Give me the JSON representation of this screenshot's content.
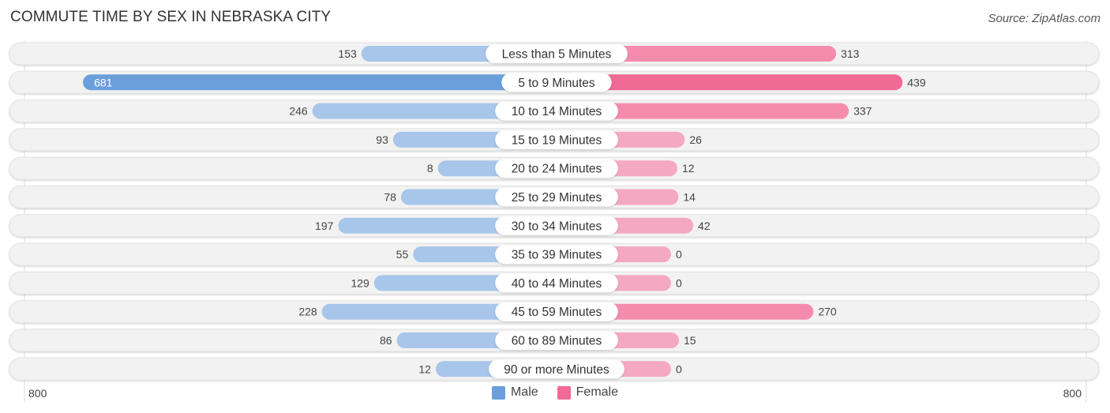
{
  "header": {
    "title": "COMMUTE TIME BY SEX IN NEBRASKA CITY",
    "source": "Source: ZipAtlas.com"
  },
  "legend": {
    "male_label": "Male",
    "female_label": "Female"
  },
  "colors": {
    "male": "#6a9fdb",
    "male_light": "#a7c6ea",
    "female": "#f06a95",
    "female_light": "#f5a8c1",
    "track": "#f2f2f2"
  },
  "chart_data": {
    "type": "bar",
    "orientation": "horizontal-diverging",
    "title": "COMMUTE TIME BY SEX IN NEBRASKA CITY",
    "categories": [
      "Less than 5 Minutes",
      "5 to 9 Minutes",
      "10 to 14 Minutes",
      "15 to 19 Minutes",
      "20 to 24 Minutes",
      "25 to 29 Minutes",
      "30 to 34 Minutes",
      "35 to 39 Minutes",
      "40 to 44 Minutes",
      "45 to 59 Minutes",
      "60 to 89 Minutes",
      "90 or more Minutes"
    ],
    "series": [
      {
        "name": "Male",
        "values": [
          153,
          681,
          246,
          93,
          8,
          78,
          197,
          55,
          129,
          228,
          86,
          12
        ]
      },
      {
        "name": "Female",
        "values": [
          313,
          439,
          337,
          26,
          12,
          14,
          42,
          0,
          0,
          270,
          15,
          0
        ]
      }
    ],
    "axis": {
      "left_tick": "800",
      "right_tick": "800",
      "range": [
        0,
        800
      ]
    },
    "legend_position": "bottom-center"
  }
}
